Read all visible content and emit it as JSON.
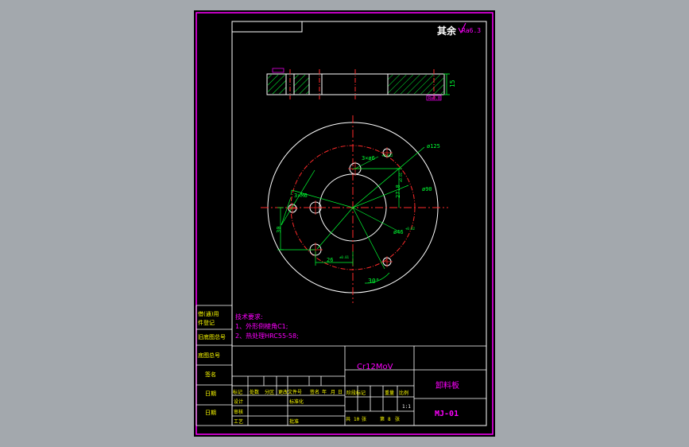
{
  "drawing": {
    "surface_note": "其余",
    "surface_symbol": "Ra6.3",
    "thickness_dim": "15",
    "side_view_callout": "Ra0.8"
  },
  "dimensions": {
    "outer_dia": "ø125",
    "pcd_dia": "ø90",
    "bore_dia": "ø46",
    "bore_tol": "+0.02",
    "screw_holes": "3×M6",
    "pin_holes": "3×ø6",
    "pin_tol": "+0.012",
    "y_offset": "27.8",
    "y_offset_tol": "±0.01",
    "vert_30": "30",
    "horiz_26": "26",
    "horiz_26_tol": "±0.01",
    "angle": "30°"
  },
  "notes": {
    "heading": "技术要求:",
    "line1": "1、外形倒棱角C1;",
    "line2": "2、热处理HRC55-58;"
  },
  "left_column": {
    "cell1": "借(通)用",
    "cell1b": "件登记",
    "cell2": "旧底图总号",
    "cell3": "底图总号",
    "cell4": "签名",
    "cell5": "日期",
    "cell6": "日期"
  },
  "title_block": {
    "material": "Cr12MoV",
    "part_name": "卸料板",
    "drawing_no": "MJ-01",
    "scale": "1:1",
    "rev_headers": [
      "标记",
      "处数",
      "分区",
      "更改文件号",
      "签名",
      "年",
      "月",
      "日"
    ],
    "roles": [
      "设计",
      "标准化",
      "审核",
      "工艺",
      "批准"
    ],
    "stage_headers": [
      "阶段标记",
      "重量",
      "比例"
    ],
    "sheet_total_label": "共",
    "sheet_total": "10",
    "sheet_unit": "张",
    "sheet_no_label": "第",
    "sheet_no": "8",
    "sheet_no_unit": "张"
  },
  "colors": {
    "frame": "#ff00ff",
    "geometry": "#ffffff",
    "center": "#ff2a2a",
    "dim": "#00ff33",
    "text": "#ff00ff",
    "yellow": "#ffff00"
  }
}
